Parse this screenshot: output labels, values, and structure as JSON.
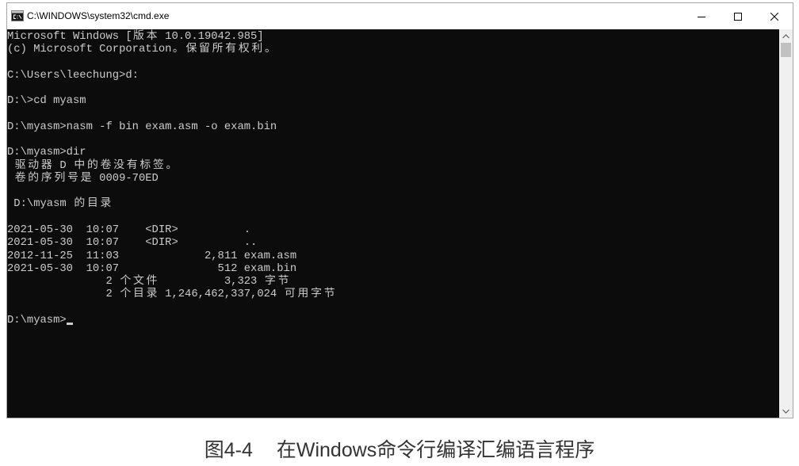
{
  "window": {
    "title": "C:\\WINDOWS\\system32\\cmd.exe",
    "icons": {
      "app": "cmd-icon",
      "minimize": "minimize-icon",
      "maximize": "maximize-icon",
      "close": "close-icon"
    }
  },
  "console": {
    "background": "#0c0c0c",
    "foreground": "#cccccc",
    "lines": [
      "Microsoft Windows [版本 10.0.19042.985]",
      "(c) Microsoft Corporation。保留所有权利。",
      "",
      "C:\\Users\\leechung>d:",
      "",
      "D:\\>cd myasm",
      "",
      "D:\\myasm>nasm -f bin exam.asm -o exam.bin",
      "",
      "D:\\myasm>dir",
      " 驱动器 D 中的卷没有标签。",
      " 卷的序列号是 0009-70ED",
      "",
      " D:\\myasm 的目录",
      "",
      "2021-05-30  10:07    <DIR>          .",
      "2021-05-30  10:07    <DIR>          ..",
      "2012-11-25  11:03             2,811 exam.asm",
      "2021-05-30  10:07               512 exam.bin",
      "               2 个文件          3,323 字节",
      "               2 个目录 1,246,462,337,024 可用字节",
      "",
      "D:\\myasm>"
    ]
  },
  "scrollbar": {
    "icons": {
      "up": "chevron-up-icon",
      "down": "chevron-down-icon"
    },
    "scroll_position": 0
  },
  "caption": {
    "figure_number": "图4-4",
    "title": "在Windows命令行编译汇编语言程序"
  }
}
